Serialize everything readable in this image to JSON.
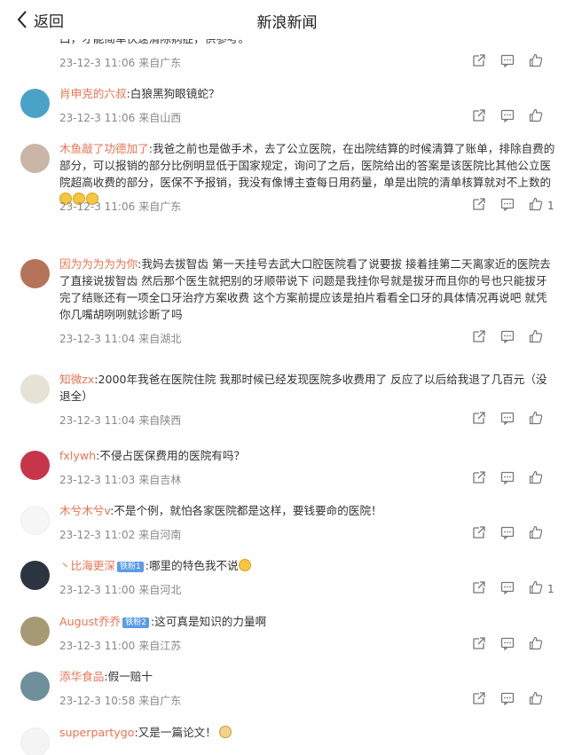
{
  "header": {
    "back_label": "返回",
    "title": "新浪新闻"
  },
  "comments": [
    {
      "user": "",
      "text": "口，才能简单快速清除病症，供参考。",
      "time": "23-12-3 11:06",
      "from": "来自广东",
      "likes": "",
      "avatar_color": "#ffffff"
    },
    {
      "user": "肖申克的六叔",
      "text": ":白狼黑狗眼镜蛇？",
      "time": "23-12-3 11:06",
      "from": "来自山西",
      "likes": "",
      "avatar_color": "#4aa3c7"
    },
    {
      "user": "木鱼敲了功德加了",
      "text": ":我爸之前也是做手术，去了公立医院，在出院结算的时候清算了账单，排除自费的部分，可以报销的部分比例明显低于国家规定，询问了之后，医院给出的答案是该医院比其他公立医院超高收费的部分，医保不予报销，我没有像博主查每日用药量，单是出院的清单核算就对不上数的",
      "time": "23-12-3 11:06",
      "from": "来自广东",
      "likes": "1",
      "avatar_color": "#c9b6a8"
    },
    {
      "user": "因为为为为为你",
      "text": ":我妈去拔智齿 第一天挂号去武大口腔医院看了说要拔 接着挂第二天离家近的医院去了直接说拔智齿 然后那个医生就把别的牙顺带说下 问题是我挂你号就是拔牙而且你的号也只能拔牙 完了结账还有一项全口牙治疗方案收费 这个方案前提应该是拍片看看全口牙的具体情况再说吧 就凭你几嘴胡咧咧就诊断了吗",
      "time": "23-12-3 11:04",
      "from": "来自湖北",
      "likes": "",
      "avatar_color": "#b5735a"
    },
    {
      "user": "知微zx",
      "text": ":2000年我爸在医院住院 我那时候已经发现医院多收费用了 反应了以后给我退了几百元（没退全）",
      "time": "23-12-3 11:04",
      "from": "来自陕西",
      "likes": "",
      "avatar_color": "#e7e3d4"
    },
    {
      "user": "fxlywh",
      "text": ":不侵占医保费用的医院有吗？",
      "time": "23-12-3 11:03",
      "from": "来自吉林",
      "likes": "",
      "avatar_color": "#c7354a"
    },
    {
      "user": "木兮木兮v",
      "text": ":不是个例，就怕各家医院都是这样，要钱要命的医院！",
      "time": "23-12-3 11:02",
      "from": "来自河南",
      "likes": "",
      "avatar_color": "#f6f6f6"
    },
    {
      "user": "丶比海更深",
      "badge": "铁粉1",
      "text": ":哪里的特色我不说",
      "time": "23-12-3 11:00",
      "from": "来自河北",
      "likes": "1",
      "avatar_color": "#2d3441"
    },
    {
      "user": "August乔乔",
      "badge": "铁粉2",
      "text": ":这可真是知识的力量啊",
      "time": "23-12-3 11:00",
      "from": "来自江苏",
      "likes": "",
      "avatar_color": "#a59a74"
    },
    {
      "user": "添华食品",
      "text": ":假一赔十",
      "time": "23-12-3 10:58",
      "from": "来自广东",
      "likes": "",
      "avatar_color": "#6f8f9a"
    },
    {
      "user": "superpartygo",
      "text": ":又是一篇论文！",
      "time": "",
      "from": "",
      "likes": "",
      "avatar_color": "#f4f4f4"
    }
  ]
}
